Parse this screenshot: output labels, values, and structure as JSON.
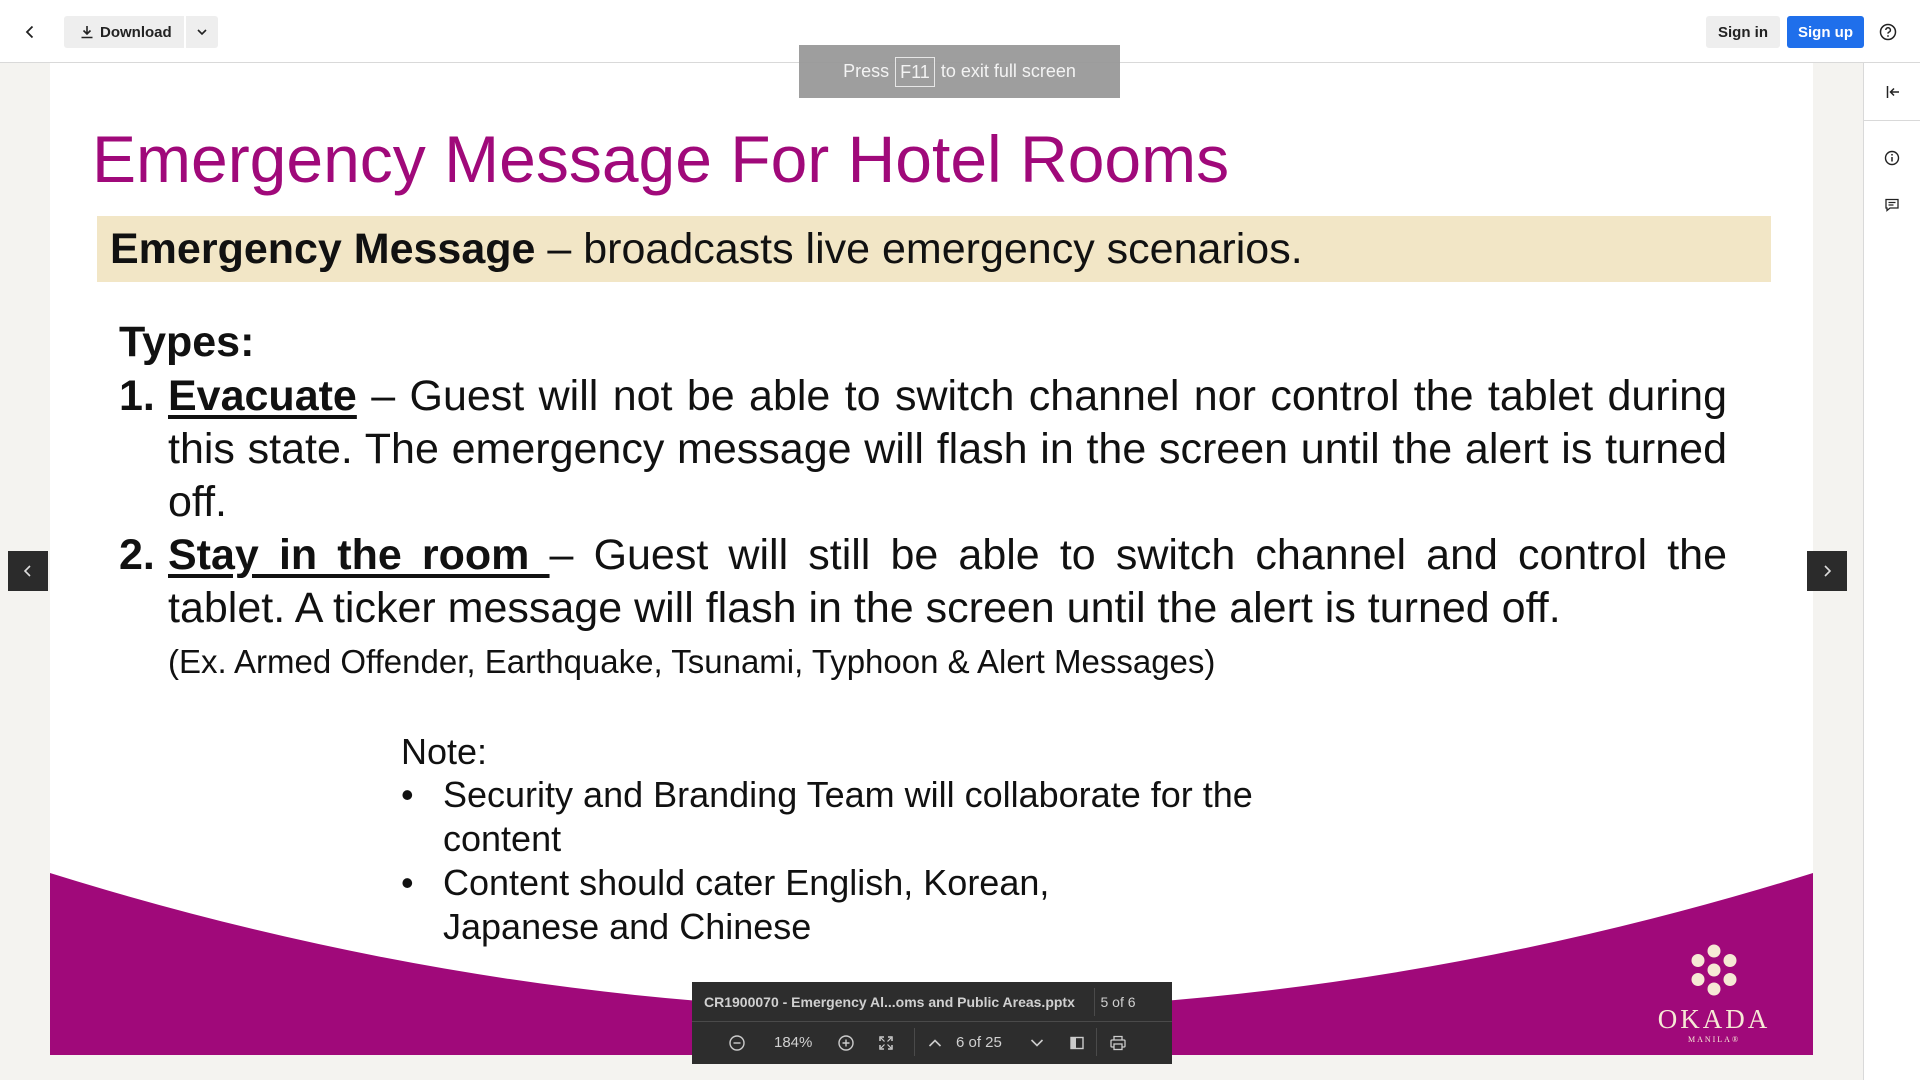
{
  "toolbar": {
    "download_label": "Download",
    "signin_label": "Sign in",
    "signup_label": "Sign up",
    "accent": "#1f6feb"
  },
  "toast": {
    "prefix": "Press",
    "key": "F11",
    "suffix": "to exit full screen"
  },
  "slide": {
    "title": "Emergency Message For Hotel Rooms",
    "title_color": "#a0097a",
    "banner_bold": "Emergency Message",
    "banner_rest": " – broadcasts live emergency scenarios.",
    "banner_color": "#f2e6c6",
    "types_label": "Types:",
    "items": [
      {
        "num": "1.",
        "term": "Evacuate",
        "text": " – Guest will not be able to switch channel nor control the tablet during this state. The emergency message will flash in the screen until the alert is turned off."
      },
      {
        "num": "2.",
        "term": "Stay in the room ",
        "text": "– Guest will still be able to switch channel and control the tablet. A ticker message will flash in the screen until the alert is turned off."
      }
    ],
    "example": "(Ex. Armed Offender, Earthquake, Tsunami, Typhoon & Alert Messages)",
    "note_label": "Note:",
    "notes": [
      "Security and Branding Team will collaborate for the content",
      "Content should cater English, Korean, Japanese and Chinese"
    ],
    "bullet": "•",
    "logo_word": "OKADA",
    "logo_sub": "MANILA®",
    "swoosh_color": "#a0097a"
  },
  "viewer": {
    "filename": "CR1900070 - Emergency Al...oms and Public Areas.pptx",
    "file_position": "5 of 6",
    "zoom": "184%",
    "page_position": "6 of 25"
  }
}
